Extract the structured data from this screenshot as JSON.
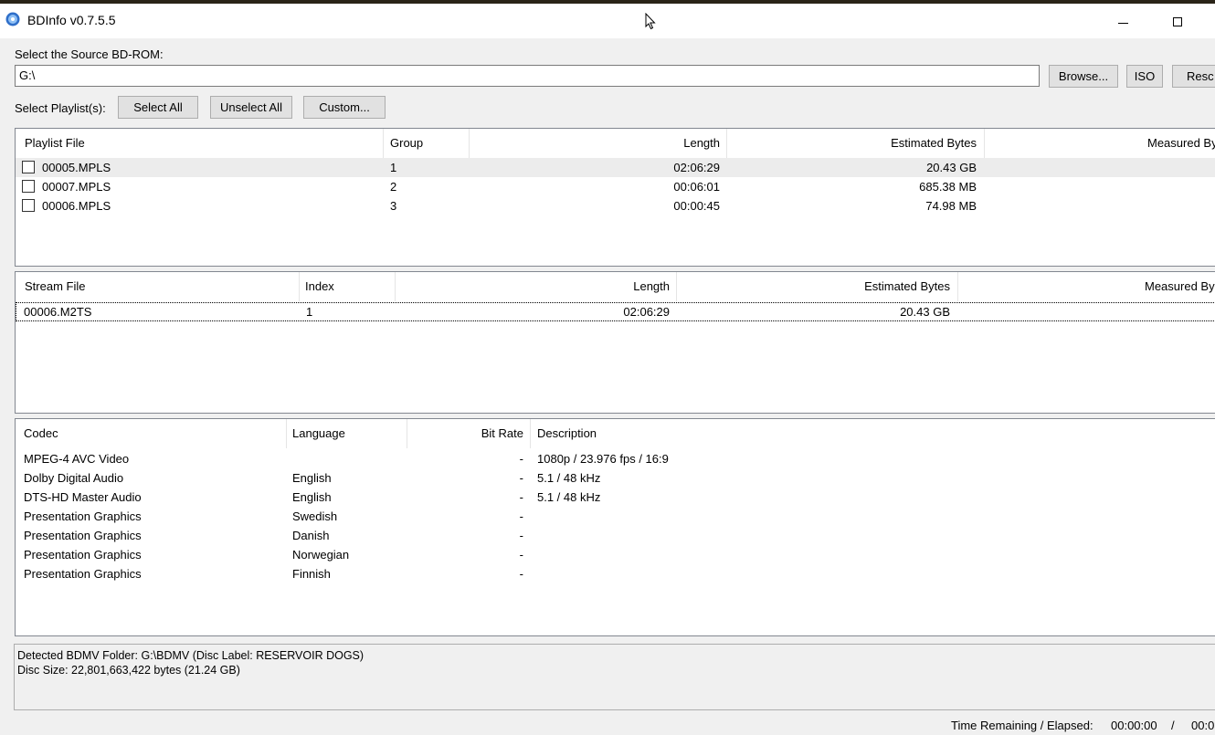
{
  "window": {
    "title": "BDInfo v0.7.5.5"
  },
  "source": {
    "label": "Select the Source BD-ROM:",
    "path": "G:\\"
  },
  "buttons": {
    "browse": "Browse...",
    "iso": "ISO",
    "rescan": "Resc"
  },
  "playlist_bar": {
    "label": "Select Playlist(s):",
    "select_all": "Select All",
    "unselect_all": "Unselect All",
    "custom": "Custom..."
  },
  "playlists": {
    "columns": [
      "Playlist File",
      "Group",
      "Length",
      "Estimated Bytes",
      "Measured By"
    ],
    "rows": [
      {
        "file": "00005.MPLS",
        "group": "1",
        "length": "02:06:29",
        "bytes": "20.43 GB"
      },
      {
        "file": "00007.MPLS",
        "group": "2",
        "length": "00:06:01",
        "bytes": "685.38 MB"
      },
      {
        "file": "00006.MPLS",
        "group": "3",
        "length": "00:00:45",
        "bytes": "74.98 MB"
      }
    ]
  },
  "streams": {
    "columns": [
      "Stream File",
      "Index",
      "Length",
      "Estimated Bytes",
      "Measured By"
    ],
    "rows": [
      {
        "file": "00006.M2TS",
        "index": "1",
        "length": "02:06:29",
        "bytes": "20.43 GB"
      }
    ]
  },
  "codecs": {
    "columns": [
      "Codec",
      "Language",
      "Bit Rate",
      "Description"
    ],
    "rows": [
      {
        "codec": "MPEG-4 AVC Video",
        "language": "",
        "bitrate": "-",
        "description": "1080p / 23.976 fps / 16:9"
      },
      {
        "codec": "Dolby Digital Audio",
        "language": "English",
        "bitrate": "-",
        "description": "5.1 / 48 kHz"
      },
      {
        "codec": "DTS-HD Master Audio",
        "language": "English",
        "bitrate": "-",
        "description": "5.1 / 48 kHz"
      },
      {
        "codec": "Presentation Graphics",
        "language": "Swedish",
        "bitrate": "-",
        "description": ""
      },
      {
        "codec": "Presentation Graphics",
        "language": "Danish",
        "bitrate": "-",
        "description": ""
      },
      {
        "codec": "Presentation Graphics",
        "language": "Norwegian",
        "bitrate": "-",
        "description": ""
      },
      {
        "codec": "Presentation Graphics",
        "language": "Finnish",
        "bitrate": "-",
        "description": ""
      }
    ]
  },
  "status": {
    "line1": "Detected BDMV Folder: G:\\BDMV (Disc Label: RESERVOIR DOGS)",
    "line2": "Disc Size: 22,801,663,422 bytes (21.24 GB)"
  },
  "time": {
    "label": "Time Remaining / Elapsed:",
    "remaining": "00:00:00",
    "separator": "/",
    "elapsed": "00:0"
  },
  "icons": {
    "app": "bluray-disc-icon",
    "cursor": "mouse-cursor-icon",
    "minimize": "minimize-icon",
    "maximize": "maximize-icon"
  },
  "colors": {
    "window_bg": "#f0f0f0",
    "list_bg": "#ffffff",
    "selected_row": "#ececec",
    "button_bg": "#e1e1e1"
  }
}
